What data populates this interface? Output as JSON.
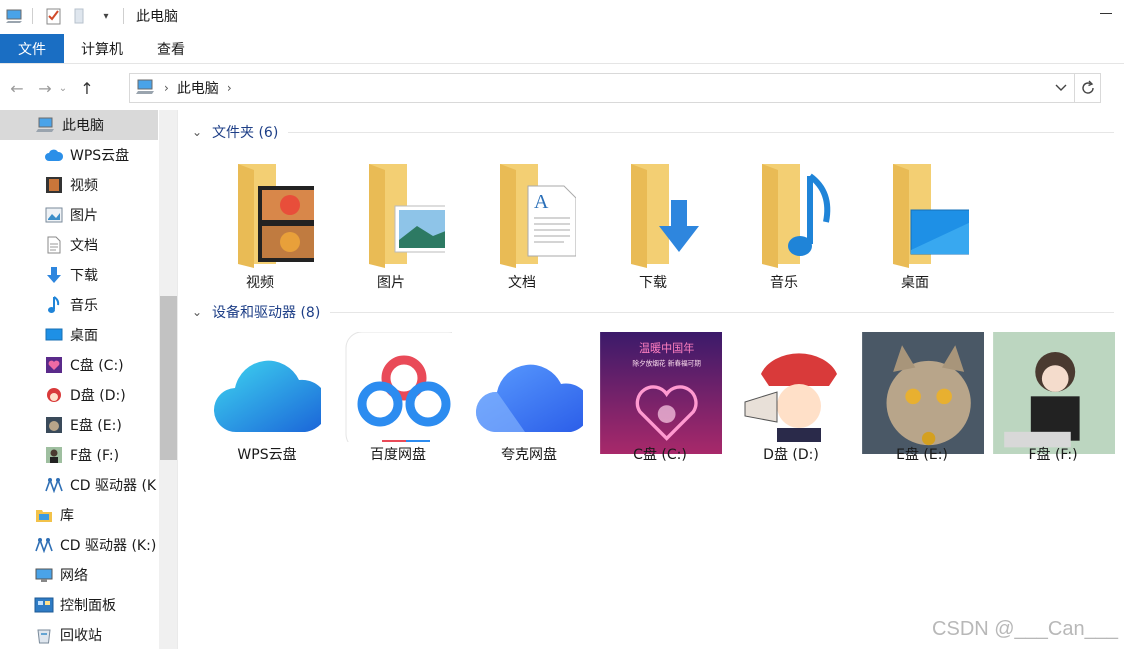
{
  "window": {
    "title": "此电脑"
  },
  "ribbon": {
    "tabs": [
      "文件",
      "计算机",
      "查看"
    ]
  },
  "address": {
    "crumb": "此电脑"
  },
  "sidebar": {
    "items": [
      {
        "label": "此电脑",
        "icon": "computer-icon",
        "indent": 1,
        "selected": true
      },
      {
        "label": "WPS云盘",
        "icon": "cloud-icon",
        "indent": 2
      },
      {
        "label": "视频",
        "icon": "video-icon",
        "indent": 2
      },
      {
        "label": "图片",
        "icon": "picture-icon",
        "indent": 2
      },
      {
        "label": "文档",
        "icon": "document-icon",
        "indent": 2
      },
      {
        "label": "下载",
        "icon": "download-icon",
        "indent": 2
      },
      {
        "label": "音乐",
        "icon": "music-icon",
        "indent": 2
      },
      {
        "label": "桌面",
        "icon": "desktop-icon",
        "indent": 2
      },
      {
        "label": "C盘 (C:)",
        "icon": "drive-c-icon",
        "indent": 2
      },
      {
        "label": "D盘 (D:)",
        "icon": "drive-d-icon",
        "indent": 2
      },
      {
        "label": "E盘 (E:)",
        "icon": "drive-e-icon",
        "indent": 2
      },
      {
        "label": "F盘 (F:)",
        "icon": "drive-f-icon",
        "indent": 2
      },
      {
        "label": "CD 驱动器 (K",
        "icon": "cd-drive-icon",
        "indent": 2
      },
      {
        "label": "库",
        "icon": "library-icon",
        "indent": 1
      },
      {
        "label": "CD 驱动器 (K:)",
        "icon": "cd-drive-icon",
        "indent": 1
      },
      {
        "label": "网络",
        "icon": "network-icon",
        "indent": 1
      },
      {
        "label": "控制面板",
        "icon": "control-panel-icon",
        "indent": 1
      },
      {
        "label": "回收站",
        "icon": "recycle-bin-icon",
        "indent": 1
      }
    ]
  },
  "groups": {
    "folders": {
      "title": "文件夹 (6)",
      "items": [
        {
          "label": "视频",
          "icon": "video-folder-icon"
        },
        {
          "label": "图片",
          "icon": "picture-folder-icon"
        },
        {
          "label": "文档",
          "icon": "document-folder-icon"
        },
        {
          "label": "下载",
          "icon": "download-folder-icon"
        },
        {
          "label": "音乐",
          "icon": "music-folder-icon"
        },
        {
          "label": "桌面",
          "icon": "desktop-folder-icon"
        }
      ]
    },
    "devices": {
      "title": "设备和驱动器 (8)",
      "items": [
        {
          "label": "WPS云盘",
          "icon": "wps-cloud-icon"
        },
        {
          "label": "百度网盘",
          "icon": "baidu-netdisk-icon"
        },
        {
          "label": "夸克网盘",
          "icon": "quark-netdisk-icon"
        },
        {
          "label": "C盘 (C:)",
          "icon": "drive-c-icon"
        },
        {
          "label": "D盘 (D:)",
          "icon": "drive-d-icon"
        },
        {
          "label": "E盘 (E:)",
          "icon": "drive-e-icon"
        },
        {
          "label": "F盘 (F:)",
          "icon": "drive-f-icon"
        }
      ]
    }
  },
  "drive_c_image_text": {
    "line1": "温暖中国年",
    "line2": "除夕放烟花 新春福可期"
  },
  "watermark": "CSDN @___Can___",
  "colors": {
    "accent": "#1a6ec3",
    "group_header": "#1e3f87",
    "folder": "#f5d77e",
    "selected": "#d9d9d9"
  }
}
